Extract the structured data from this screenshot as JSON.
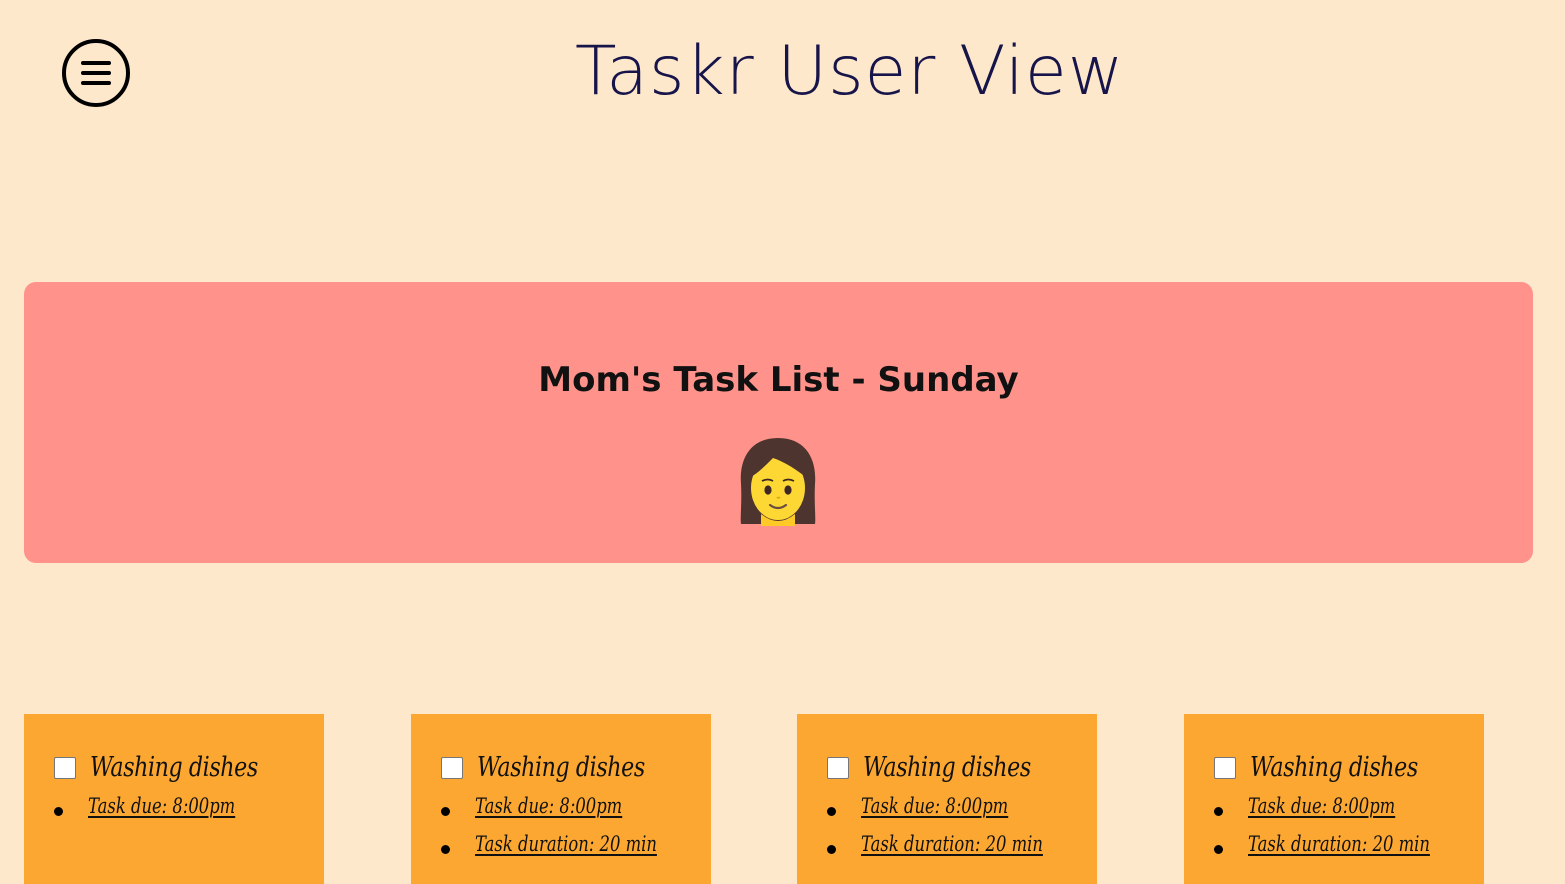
{
  "header": {
    "title": "Taskr User View",
    "menu_icon": "hamburger-menu-icon"
  },
  "banner": {
    "title": "Mom's Task List - Sunday",
    "avatar": "👩",
    "color": "#ff938b"
  },
  "colors": {
    "page_background": "#fde8cc",
    "card_background": "#fca732",
    "title_color": "#17144a"
  },
  "cards": [
    {
      "name": "Washing dishes",
      "checked": false,
      "details": [
        "Task due: 8:00pm"
      ]
    },
    {
      "name": "Washing dishes",
      "checked": false,
      "details": [
        "Task due: 8:00pm",
        "Task duration: 20 min"
      ]
    },
    {
      "name": "Washing dishes",
      "checked": false,
      "details": [
        "Task due: 8:00pm",
        "Task duration: 20 min"
      ]
    },
    {
      "name": "Washing dishes",
      "checked": false,
      "details": [
        "Task due: 8:00pm",
        "Task duration: 20 min"
      ]
    }
  ]
}
